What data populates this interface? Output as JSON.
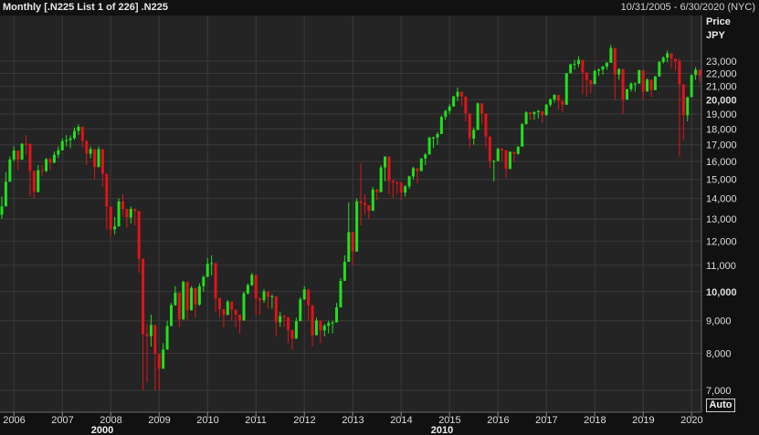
{
  "header": {
    "title": "Monthly [.N225 List 1 of 226] .N225",
    "date_range": "10/31/2005 - 6/30/2020 (NYC)"
  },
  "axis": {
    "y_title": "Price",
    "y_unit": "JPY",
    "auto_label": "Auto"
  },
  "colors": {
    "background": "#111111",
    "plot_background": "#242424",
    "grid": "#3a3a3a",
    "up": "#22e01e",
    "down": "#e0141a",
    "text": "#e9e9e9"
  },
  "chart_data": {
    "type": "candlestick",
    "interval": "Monthly",
    "grid": true,
    "y_scale": "log",
    "ylim": [
      6700,
      23800
    ],
    "y_ticks": [
      {
        "value": 23000,
        "label": "23,000"
      },
      {
        "value": 22000,
        "label": "22,000"
      },
      {
        "value": 21000,
        "label": "21,000"
      },
      {
        "value": 20000,
        "label": "20,000"
      },
      {
        "value": 19000,
        "label": "19,000"
      },
      {
        "value": 18000,
        "label": "18,000"
      },
      {
        "value": 17000,
        "label": "17,000"
      },
      {
        "value": 16000,
        "label": "16,000"
      },
      {
        "value": 15000,
        "label": "15,000"
      },
      {
        "value": 14000,
        "label": "14,000"
      },
      {
        "value": 13000,
        "label": "13,000"
      },
      {
        "value": 12000,
        "label": "12,000"
      },
      {
        "value": 11000,
        "label": "11,000"
      },
      {
        "value": 10000,
        "label": "10,000"
      },
      {
        "value": 9000,
        "label": "9,000"
      },
      {
        "value": 8000,
        "label": "8,000"
      },
      {
        "value": 7000,
        "label": "7,000"
      }
    ],
    "bold_y_ticks": [
      20000,
      10000
    ],
    "x_ticks": [
      "2006",
      "2007",
      "2008",
      "2009",
      "2010",
      "2011",
      "2012",
      "2013",
      "2014",
      "2015",
      "2016",
      "2017",
      "2018",
      "2019",
      "2020"
    ],
    "x_decades": [
      "2000",
      "2010"
    ],
    "x_start": "2005-10",
    "x_end": "2020-06",
    "closes": [
      13606,
      14872,
      16111,
      16650,
      16103,
      17060,
      17059,
      15467,
      14327,
      15506,
      15457,
      16141,
      15934,
      16399,
      16661,
      17226,
      17288,
      17400,
      17875,
      18138,
      17248,
      16460,
      16738,
      15681,
      16737,
      15307,
      13592,
      12525,
      12657,
      13850,
      13482,
      13072,
      13481,
      13377,
      11260,
      8577,
      8512,
      8860,
      7994,
      7568,
      8110,
      8829,
      9523,
      9958,
      9040,
      10357,
      9345,
      10134,
      9543,
      10198,
      10546,
      11057,
      11089,
      9768,
      9383,
      9191,
      9643,
      9369,
      9202,
      9010,
      9937,
      10238,
      10624,
      9755,
      9694,
      10004,
      9816,
      9833,
      8955,
      9154,
      9113,
      8700,
      8434,
      8988,
      9723,
      10084,
      9520,
      8542,
      9007,
      8695,
      8840,
      8928,
      8946,
      9446,
      10395,
      11138,
      12397,
      11559,
      13860,
      13775,
      13668,
      13389,
      14455,
      14327,
      15662,
      16291,
      14915,
      14841,
      14828,
      14304,
      14632,
      15162,
      15620,
      15457,
      16174,
      16414,
      17451,
      17451,
      17674,
      18798,
      19207,
      19520,
      20236,
      20585,
      20236,
      19034,
      17388,
      17930,
      19747,
      19034,
      17518,
      16027,
      16027,
      16758,
      16667,
      15576,
      16570,
      16450,
      16887,
      18308,
      19114,
      18991,
      19119,
      19197,
      18909,
      19651,
      20033,
      20356,
      19925,
      19646,
      22012,
      22725,
      22765,
      23098,
      22068,
      21454,
      21159,
      22202,
      22305,
      22554,
      22865,
      24120,
      21920,
      22351,
      20015,
      20773,
      21206,
      21206,
      22259,
      20601,
      21522,
      20704,
      21756,
      22927,
      23294,
      23656,
      23205,
      22977,
      21143,
      18917,
      20194,
      21877,
      22288,
      21800
    ],
    "wicks_low": [
      13000,
      14500,
      15300,
      16000,
      15500,
      16600,
      16400,
      14100,
      14000,
      14800,
      15200,
      15400,
      15500,
      15900,
      16200,
      16700,
      16900,
      16800,
      17300,
      17600,
      16800,
      15800,
      16200,
      15000,
      16000,
      14600,
      12500,
      12200,
      12300,
      13000,
      13100,
      12600,
      12800,
      12700,
      10700,
      7000,
      7200,
      8200,
      7000,
      7000,
      7700,
      8300,
      9100,
      9500,
      8800,
      9700,
      9000,
      9600,
      9100,
      9500,
      10000,
      10700,
      10600,
      9300,
      9100,
      8800,
      9200,
      9000,
      8800,
      8600,
      9400,
      9900,
      10200,
      9200,
      9200,
      9600,
      9400,
      9400,
      8500,
      8800,
      8800,
      8300,
      8100,
      8600,
      9200,
      9700,
      9000,
      8200,
      8600,
      8300,
      8500,
      8600,
      8600,
      9000,
      9900,
      10700,
      11800,
      11000,
      12500,
      12700,
      13200,
      13000,
      13800,
      13900,
      14700,
      14900,
      14200,
      14000,
      14200,
      13900,
      14100,
      14500,
      15000,
      14800,
      15500,
      15800,
      16600,
      16800,
      17000,
      18000,
      18600,
      19000,
      19600,
      19900,
      19600,
      18500,
      16800,
      17000,
      18800,
      18300,
      16800,
      15600,
      14900,
      16200,
      16000,
      15100,
      16100,
      16000,
      16400,
      17700,
      18600,
      18600,
      18600,
      18700,
      18400,
      19000,
      19500,
      19800,
      19300,
      19100,
      21200,
      22100,
      22300,
      22500,
      20400,
      20200,
      20500,
      21500,
      21800,
      21900,
      22300,
      23000,
      20000,
      21500,
      19000,
      20200,
      20600,
      20600,
      21500,
      20000,
      20600,
      20200,
      21000,
      22200,
      22800,
      22900,
      22400,
      22200,
      16300,
      17300,
      18500,
      20400,
      21500,
      21300
    ],
    "wicks_high": [
      14100,
      15400,
      16300,
      16900,
      16500,
      17100,
      17600,
      15700,
      15000,
      15800,
      15800,
      16200,
      16200,
      16600,
      16900,
      17400,
      17600,
      17600,
      18100,
      18300,
      17400,
      16600,
      16900,
      15800,
      16900,
      15500,
      13800,
      13200,
      13100,
      14000,
      14200,
      13200,
      13600,
      13500,
      11600,
      9000,
      8900,
      9200,
      8500,
      7900,
      8300,
      9000,
      9600,
      10200,
      9200,
      10400,
      9400,
      10200,
      9600,
      10300,
      10600,
      11300,
      11400,
      9800,
      9500,
      9300,
      9700,
      9500,
      9300,
      9200,
      10000,
      10300,
      10700,
      9900,
      9800,
      10100,
      9900,
      9900,
      9100,
      9300,
      9200,
      8800,
      8600,
      9100,
      9800,
      10200,
      9600,
      8700,
      9100,
      8800,
      8900,
      9000,
      9000,
      9600,
      10500,
      11400,
      13800,
      11600,
      14000,
      15900,
      14200,
      13600,
      14600,
      14500,
      15800,
      16300,
      15100,
      15000,
      14900,
      14400,
      14700,
      15200,
      15700,
      15500,
      16200,
      16500,
      17500,
      17500,
      17800,
      18900,
      19300,
      19700,
      20300,
      20900,
      20300,
      19200,
      17500,
      18100,
      19800,
      19200,
      17600,
      16200,
      16100,
      16800,
      16800,
      15700,
      16600,
      16500,
      16900,
      18400,
      19200,
      19100,
      19200,
      19300,
      19000,
      19700,
      20100,
      20400,
      20000,
      19700,
      22000,
      22800,
      23100,
      23400,
      22200,
      21500,
      21200,
      22300,
      22400,
      22600,
      22900,
      24400,
      22000,
      22400,
      20100,
      20800,
      21300,
      21300,
      22300,
      20700,
      21600,
      20800,
      21800,
      23000,
      23400,
      23900,
      23400,
      23100,
      23200,
      19100,
      20200,
      21900,
      22500,
      22000
    ]
  }
}
